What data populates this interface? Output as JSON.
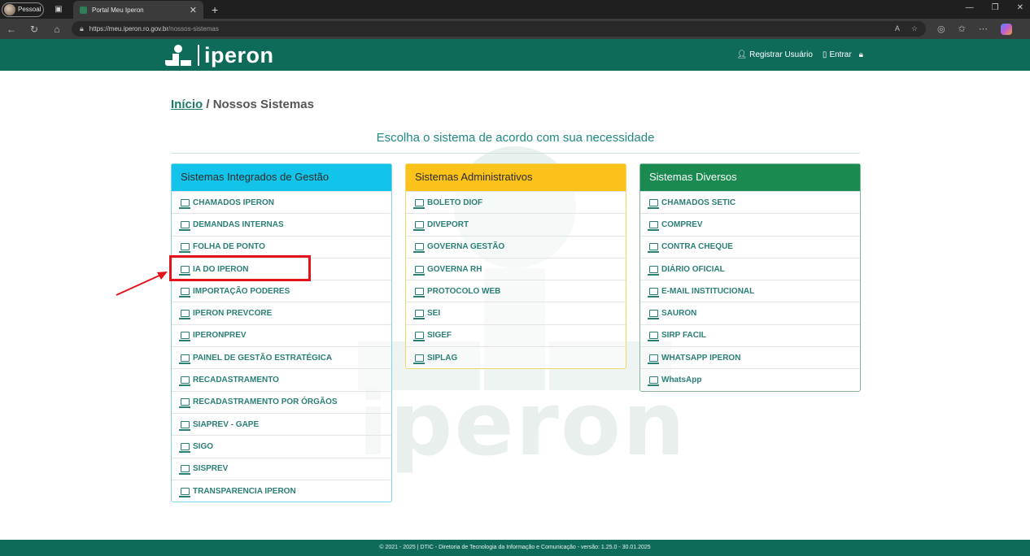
{
  "browser": {
    "profile": "Pessoal",
    "tab_title": "Portal Meu Iperon",
    "url_main": "https://meu.iperon.ro.gov.br",
    "url_path": "/nossos-sistemas"
  },
  "header": {
    "logo_text": "iperon",
    "register_label": "Registrar Usuário",
    "login_label": "Entrar"
  },
  "breadcrumb": {
    "home": "Início",
    "separator": "/",
    "current": "Nossos Sistemas"
  },
  "subtitle": "Escolha o sistema de acordo com sua necessidade",
  "watermark_text": "iperon",
  "panels": [
    {
      "title": "Sistemas Integrados de Gestão",
      "items": [
        "CHAMADOS IPERON",
        "DEMANDAS INTERNAS",
        "FOLHA DE PONTO",
        "IA DO IPERON",
        "IMPORTAÇÃO PODERES",
        "IPERON PREVCORE",
        "IPERONPREV",
        "PAINEL DE GESTÃO ESTRATÉGICA",
        "RECADASTRAMENTO",
        "RECADASTRAMENTO POR ÓRGÃOS",
        "SIAPREV - GAPE",
        "SIGO",
        "SISPREV",
        "TRANSPARENCIA IPERON"
      ]
    },
    {
      "title": "Sistemas Administrativos",
      "items": [
        "BOLETO DIOF",
        "DIVEPORT",
        "GOVERNA GESTÃO",
        "GOVERNA RH",
        "PROTOCOLO WEB",
        "SEI",
        "SIGEF",
        "SIPLAG"
      ]
    },
    {
      "title": "Sistemas Diversos",
      "items": [
        "CHAMADOS SETIC",
        "COMPREV",
        "CONTRA CHEQUE",
        "DIÁRIO OFICIAL",
        "E-MAIL INSTITUCIONAL",
        "SAURON",
        "SIRP FACIL",
        "WHATSAPP IPERON",
        "WhatsApp"
      ]
    }
  ],
  "footer": "© 2021 - 2025 | DTIC - Diretoria de Tecnologia da Informação e Comunicação - versão: 1.25.0 - 30.01.2025",
  "colors": {
    "brand": "#0e6b5a",
    "panel1": "#12c4ea",
    "panel2": "#fbc21a",
    "panel3": "#1a8a50",
    "highlight": "#e3131b"
  }
}
